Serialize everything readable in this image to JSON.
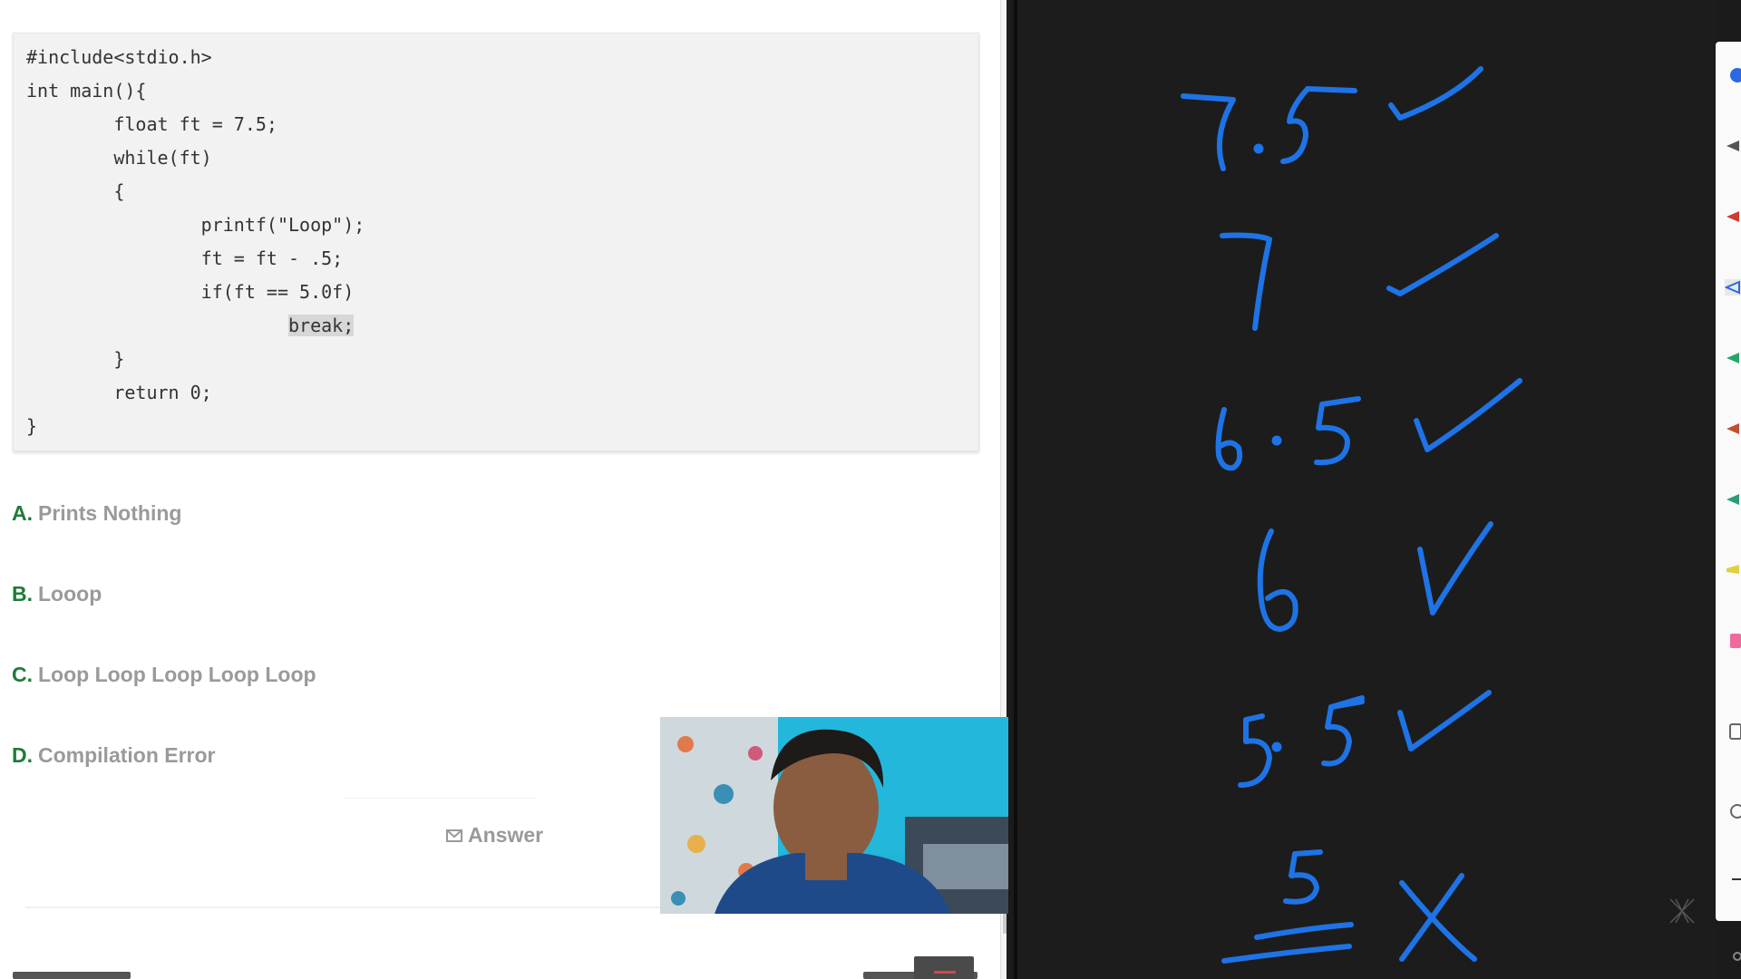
{
  "code": {
    "lines": [
      "#include<stdio.h>",
      "int main(){",
      "        float ft = 7.5;",
      "        while(ft)",
      "        {",
      "                printf(\"Loop\");",
      "                ft = ft - .5;",
      "                if(ft == 5.0f)",
      "                        ",
      "        }",
      "        return 0;",
      "}"
    ],
    "highlighted": "break;"
  },
  "options": [
    {
      "letter": "A.",
      "text": "Prints Nothing"
    },
    {
      "letter": "B.",
      "text": "Looop"
    },
    {
      "letter": "C.",
      "text": "Loop Loop Loop Loop Loop"
    },
    {
      "letter": "D.",
      "text": "Compilation Error"
    }
  ],
  "answer_label": "Answer",
  "icons": {
    "answer": "mail-icon",
    "watermark": "x-logo-icon"
  },
  "whiteboard": {
    "ink_color": "#1e73e6",
    "rows": [
      {
        "value": "7.5",
        "mark": "check"
      },
      {
        "value": "7",
        "mark": "check"
      },
      {
        "value": "6.5",
        "mark": "check"
      },
      {
        "value": "6",
        "mark": "check"
      },
      {
        "value": "5.5",
        "mark": "check"
      },
      {
        "value": "5",
        "mark": "cross"
      }
    ]
  },
  "tool_colors": [
    "#2a6ae0",
    "#555555",
    "#d13a2e",
    "#2a6ae0",
    "#2aa36b",
    "#c0502e",
    "#2a9c7a",
    "#e0d040",
    "#f06aa0"
  ]
}
